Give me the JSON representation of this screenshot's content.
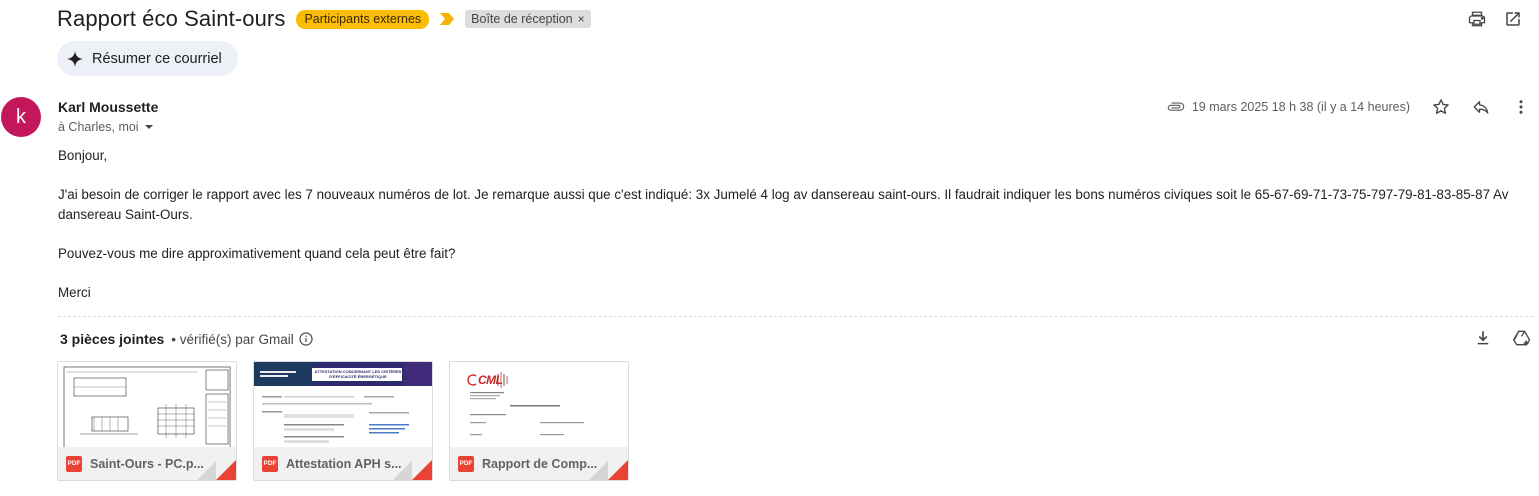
{
  "email": {
    "subject": "Rapport éco Saint-ours",
    "labels": {
      "external": "Participants externes",
      "inbox": "Boîte de réception",
      "remove_label": "×"
    },
    "summarize_label": "Résumer ce courriel",
    "avatar_letter": "k",
    "avatar_color": "#c2185b",
    "sender_name": "Karl Moussette",
    "recipients": "à Charles, moi",
    "date": "19 mars 2025 18 h 38 (il y a 14 heures)",
    "body": {
      "greeting": "Bonjour,",
      "paragraph1": "J'ai besoin de corriger le rapport avec les 7 nouveaux numéros de lot. Je remarque aussi que c'est indiqué: 3x Jumelé 4 log av dansereau saint-ours. Il faudrait indiquer les bons numéros civiques soit le 65-67-69-71-73-75-797-79-81-83-85-87 Av dansereau Saint-Ours.",
      "paragraph2": "Pouvez-vous me dire approximativement quand cela peut être fait?",
      "closing": "Merci"
    },
    "attachments": {
      "count_label": "3 pièces jointes",
      "verified_label": "• vérifié(s) par Gmail",
      "items": [
        {
          "name": "Saint-Ours - PC.p...",
          "type": "PDF"
        },
        {
          "name": "Attestation APH s...",
          "type": "PDF",
          "thumb_heading": "ATTESTATION CONCERNANT LES CRITÈRES D'EFFICACITÉ ÉNERGÉTIQUE"
        },
        {
          "name": "Rapport de Comp...",
          "type": "PDF",
          "thumb_logo": "CML"
        }
      ]
    }
  },
  "colors": {
    "label_external": "#fbbc04",
    "label_inbox": "#dddddd",
    "pdf_red": "#ea4335",
    "summarize_bg": "#edf1f7"
  },
  "icons": {
    "print": "print-icon",
    "open_new_window": "open-in-new-window-icon",
    "sparkle": "sparkle-icon",
    "paperclip": "paperclip-icon",
    "star": "star-icon",
    "reply": "reply-icon",
    "more": "more-vert-icon",
    "download_all": "download-icon",
    "add_to_drive": "add-to-drive-icon",
    "info": "info-icon",
    "importance": "importance-marker-icon",
    "caret": "caret-down-icon"
  }
}
